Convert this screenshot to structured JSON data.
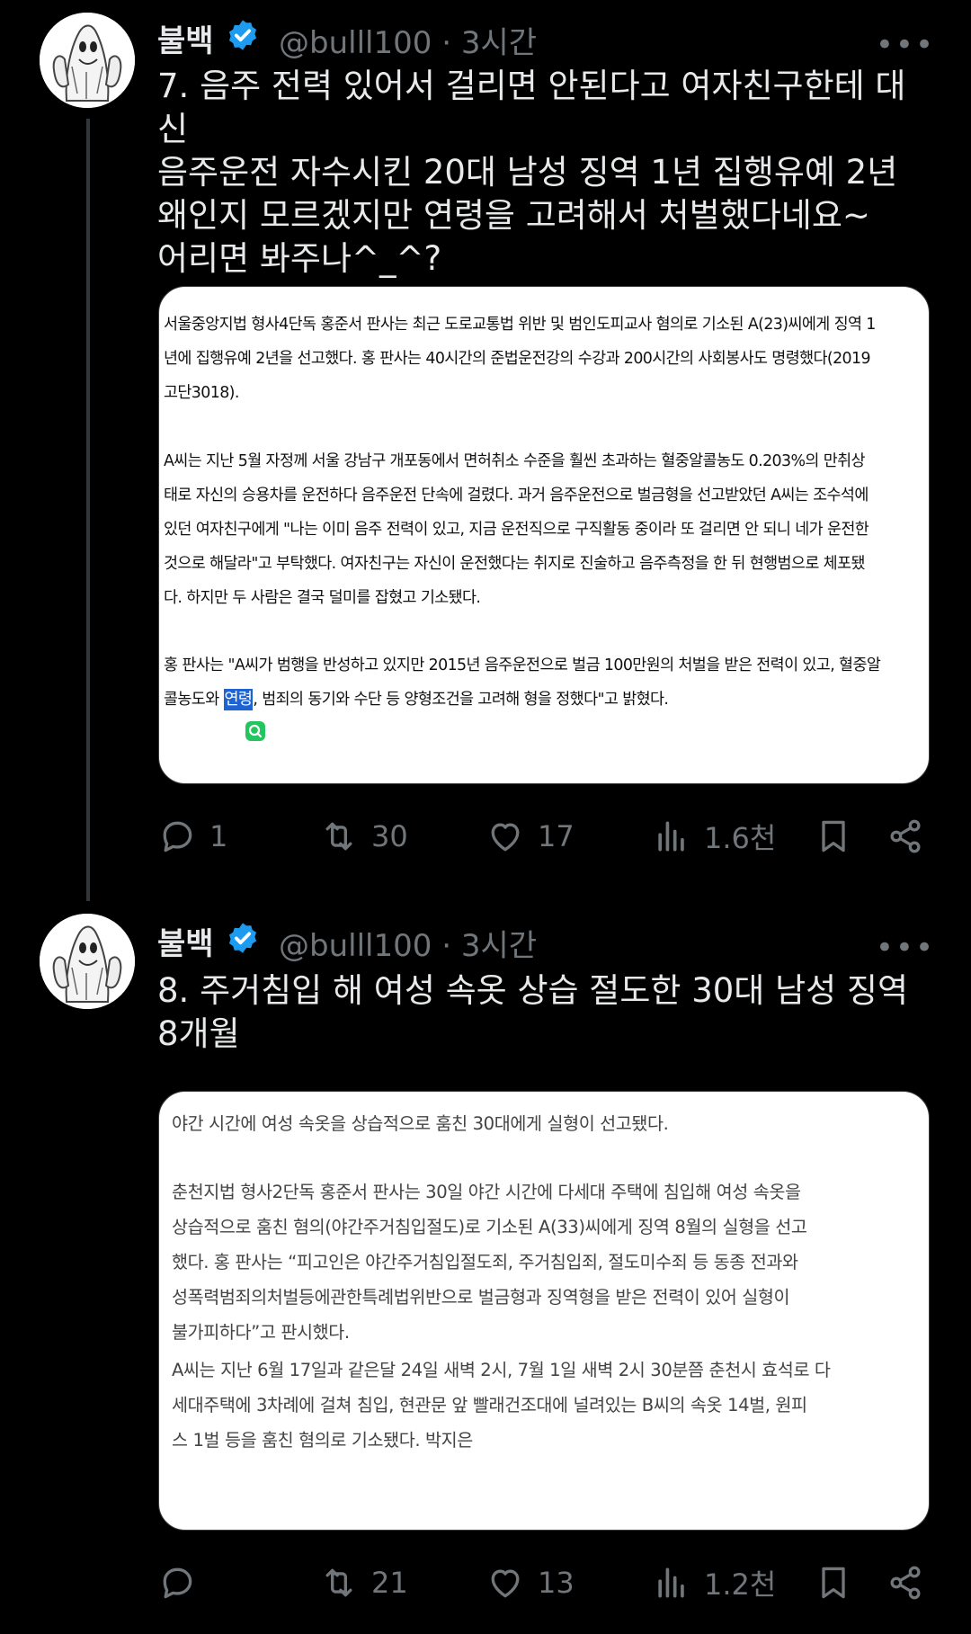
{
  "tweets": [
    {
      "author": {
        "name": "불백",
        "handle": "@bulll100",
        "time": "3시간",
        "separator": "·"
      },
      "more_label": "•••",
      "text": "7. 음주 전력 있어서 걸리면 안된다고 여자친구한테 대신\n음주운전 자수시킨 20대 남성 징역 1년 집행유예 2년\n왜인지 모르겠지만 연령을 고려해서 처벌했다네요~\n어리면 봐주나^_^?",
      "article": {
        "p1_lines": [
          "서울중앙지법 형사4단독 홍준서 판사는 최근 도로교통법 위반 및 범인도피교사 혐의로 기소된 A(23)씨에게 징역 1",
          "년에 집행유예 2년을 선고했다. 홍 판사는 40시간의 준법운전강의 수강과 200시간의 사회봉사도 명령했다(2019",
          "고단3018)."
        ],
        "p2_lines": [
          "A씨는 지난 5월 자정께 서울 강남구 개포동에서 면허취소 수준을 훨씬 초과하는 혈중알콜농도 0.203%의 만취상",
          "태로 자신의 승용차를 운전하다 음주운전 단속에 걸렸다. 과거 음주운전으로 벌금형을 선고받았던 A씨는 조수석에",
          "있던 여자친구에게 \"나는 이미 음주 전력이 있고, 지금 운전직으로 구직활동 중이라 또 걸리면 안 되니 네가 운전한",
          "것으로 해달라\"고 부탁했다. 여자친구는 자신이 운전했다는 취지로 진술하고 음주측정을 한 뒤 현행범으로 체포됐",
          "다. 하지만 두 사람은 결국 덜미를 잡혔고 기소됐다."
        ],
        "p3_line1": "홍 판사는 \"A씨가 범행을 반성하고 있지만 2015년 음주운전으로 벌금 100만원의 처벌을 받은 전력이 있고, 혈중알",
        "p3_line2_pre": "콜농도와 ",
        "p3_line2_highlight": "연령",
        "p3_line2_post": ", 범죄의 동기와 수단 등 양형조건을 고려해 형을 정했다\"고 밝혔다.",
        "lens_icon": "Q"
      },
      "stats": {
        "replies": "1",
        "retweets": "30",
        "likes": "17",
        "views": "1.6천"
      }
    },
    {
      "author": {
        "name": "불백",
        "handle": "@bulll100",
        "time": "3시간",
        "separator": "·"
      },
      "more_label": "•••",
      "text": "8. 주거침입 해 여성 속옷 상습 절도한 30대 남성 징역\n8개월",
      "article": {
        "p1_lines": [
          "야간 시간에 여성 속옷을 상습적으로 훔친 30대에게 실형이 선고됐다."
        ],
        "p2_lines": [
          "춘천지법 형사2단독 홍준서 판사는 30일 야간 시간에 다세대 주택에 침입해 여성 속옷을",
          "상습적으로 훔친 혐의(야간주거침입절도)로 기소된 A(33)씨에게 징역 8월의 실형을 선고",
          "했다. 홍 판사는 “피고인은 야간주거침입절도죄, 주거침입죄, 절도미수죄 등 동종 전과와",
          "성폭력범죄의처벌등에관한특례법위반으로 벌금형과 징역형을 받은 전력이 있어 실형이",
          "불가피하다”고 판시했다."
        ],
        "p3_lines": [
          "A씨는 지난 6월 17일과 같은달 24일 새벽 2시, 7월 1일 새벽 2시 30분쯤 춘천시 효석로 다",
          "세대주택에 3차례에 걸쳐 침입, 현관문 앞 빨래건조대에 널려있는 B씨의 속옷 14벌, 원피",
          "스 1벌 등을 훔친 혐의로 기소됐다. 박지은"
        ]
      },
      "stats": {
        "replies": "",
        "retweets": "21",
        "likes": "13",
        "views": "1.2천"
      }
    }
  ],
  "colors": {
    "background": "#000000",
    "text": "#e7e9ea",
    "muted": "#71767b",
    "verified": "#1d9bf0",
    "highlight": "#1e63d4"
  },
  "icons": [
    "reply-icon",
    "retweet-icon",
    "like-icon",
    "views-icon",
    "bookmark-icon",
    "share-icon",
    "verified-badge-icon",
    "more-icon"
  ]
}
